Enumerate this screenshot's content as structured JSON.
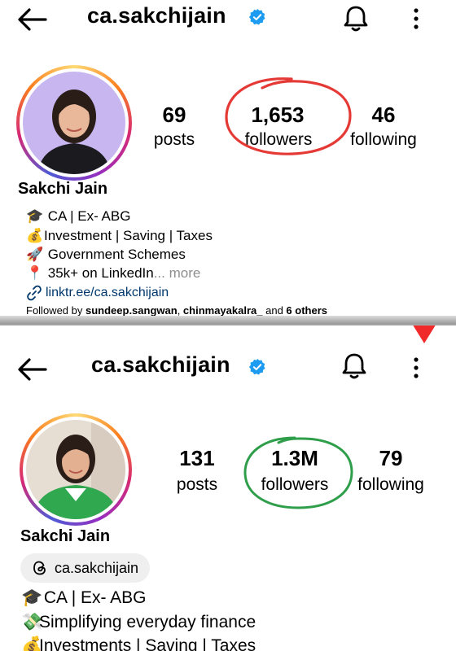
{
  "top": {
    "handle": "ca.sakchijain",
    "stats": {
      "posts": {
        "num": "69",
        "label": "posts"
      },
      "followers": {
        "num": "1,653",
        "label": "followers"
      },
      "following": {
        "num": "46",
        "label": "following"
      }
    },
    "name": "Sakchi Jain",
    "bio": [
      {
        "icon": "🎓",
        "text": "CA | Ex- ABG"
      },
      {
        "icon": "💰",
        "text": "Investment | Saving | Taxes"
      },
      {
        "icon": "🚀",
        "text": "Government Schemes"
      },
      {
        "icon": "📍",
        "text": "35k+ on LinkedIn"
      }
    ],
    "more": "... more",
    "link": "linktr.ee/ca.sakchijain",
    "followed_by": {
      "prefix": "Followed by ",
      "user1": "sundeep.sangwan",
      "sep": ", ",
      "user2": "chinmayakalra_",
      "mid": " and ",
      "others": "6 others"
    }
  },
  "bottom": {
    "handle": "ca.sakchijain",
    "stats": {
      "posts": {
        "num": "131",
        "label": "posts"
      },
      "followers": {
        "num": "1.3M",
        "label": "followers"
      },
      "following": {
        "num": "79",
        "label": "following"
      }
    },
    "name": "Sakchi Jain",
    "threads_handle": "ca.sakchijain",
    "bio": [
      {
        "icon": "🎓",
        "text": "CA | Ex- ABG"
      },
      {
        "icon": "💸",
        "text": "Simplifying everyday finance"
      },
      {
        "icon": "💰",
        "text": "Investments | Saving | Taxes"
      }
    ]
  },
  "colors": {
    "verified": "#1d9bf0",
    "red_circle": "#e53935",
    "green_circle": "#2e9e4a",
    "arrow": "#f02a2a",
    "link": "#00376b"
  },
  "icons": [
    "back-arrow-icon",
    "verified-badge-icon",
    "bell-icon",
    "more-vertical-icon",
    "link-icon",
    "threads-icon"
  ]
}
